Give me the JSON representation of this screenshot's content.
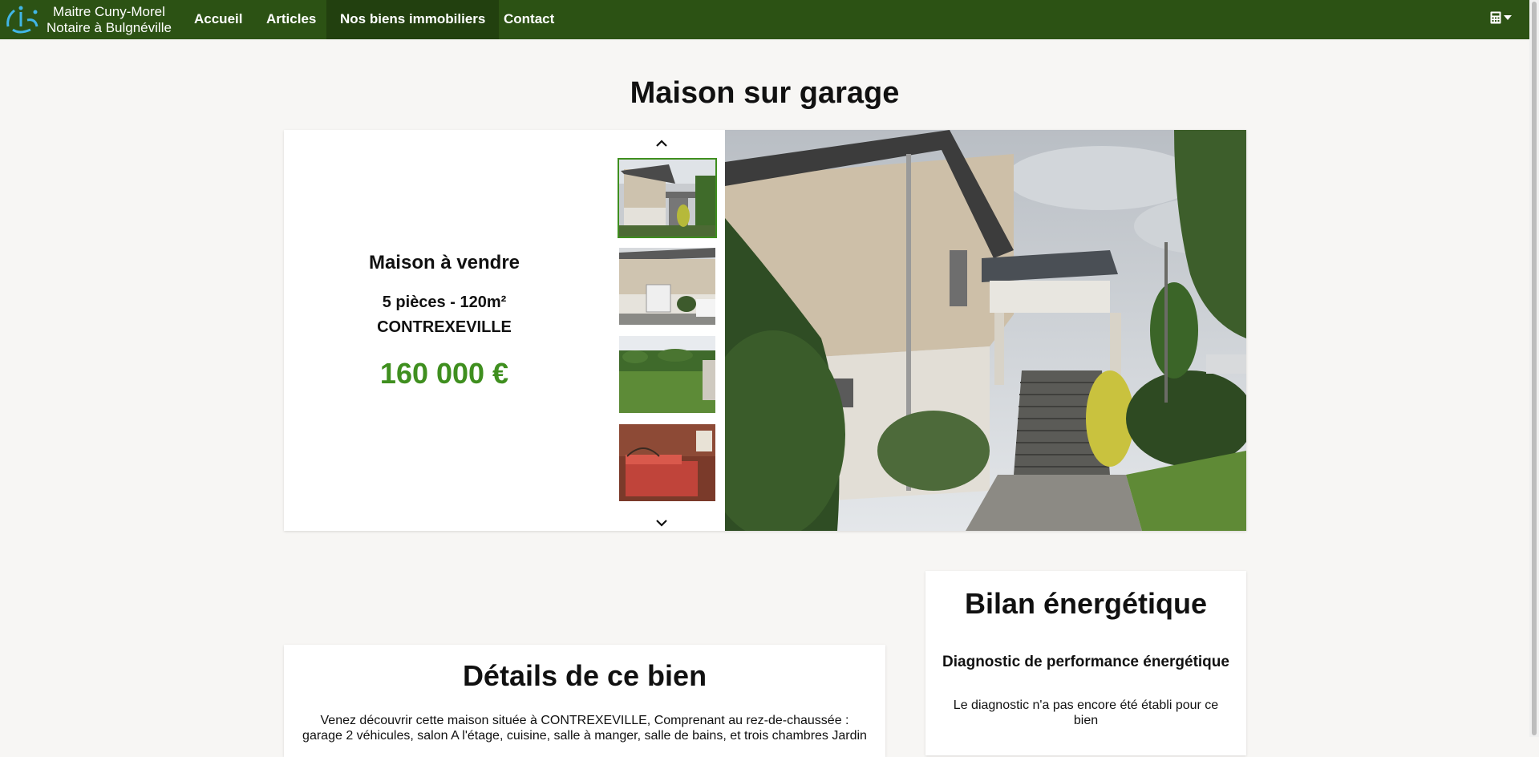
{
  "brand": {
    "line1": "Maitre Cuny-Morel",
    "line2": "Notaire à Bulgnéville"
  },
  "nav": {
    "items": [
      "Accueil",
      "Articles",
      "Nos biens immobiliers",
      "Contact"
    ],
    "active": "Nos biens immobiliers"
  },
  "icons": {
    "logo": "notary-logo",
    "tool": "calculator-icon",
    "dropdown": "caret-down-icon",
    "up": "chevron-up-icon",
    "down": "chevron-down-icon"
  },
  "colors": {
    "navbar": "#2c5214",
    "accent": "#3f8f1f",
    "background": "#f7f6f4"
  },
  "listing": {
    "title": "Maison sur garage",
    "type": "Maison à vendre",
    "rooms_area": "5 pièces - 120m²",
    "city": "CONTREXEVILLE",
    "price": "160 000 €"
  },
  "details": {
    "title": "Détails de ce bien",
    "description": "Venez découvrir cette maison située à CONTREXEVILLE, Comprenant au rez-de-chaussée : garage 2 véhicules, salon A l'étage, cuisine, salle à manger, salle de bains, et trois chambres Jardin"
  },
  "energy": {
    "title": "Bilan énergétique",
    "subtitle": "Diagnostic de performance énergétique",
    "text": "Le diagnostic n'a pas encore été établi pour ce bien"
  }
}
